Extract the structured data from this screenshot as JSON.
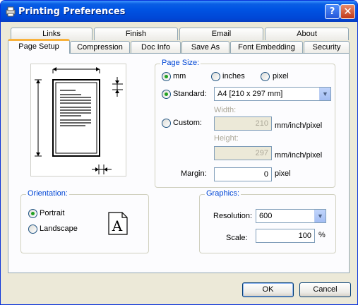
{
  "window": {
    "title": "Printing Preferences",
    "help_label": "?",
    "close_label": "✕"
  },
  "tabs_row1": [
    "Links",
    "Finish",
    "Email",
    "About"
  ],
  "tabs_row2": [
    "Page Setup",
    "Compression",
    "Doc Info",
    "Save As",
    "Font Embedding",
    "Security"
  ],
  "active_tab": "Page Setup",
  "page_size": {
    "title": "Page Size:",
    "units": [
      "mm",
      "inches",
      "pixel"
    ],
    "selected_unit": "mm",
    "standard_label": "Standard:",
    "standard_value": "A4 [210 x 297 mm]",
    "custom_label": "Custom:",
    "width_label": "Width:",
    "width_value": "210",
    "height_label": "Height:",
    "height_value": "297",
    "unit_suffix": "mm/inch/pixel",
    "selected_size": "Standard",
    "margin_label": "Margin:",
    "margin_value": "0",
    "margin_unit": "pixel"
  },
  "orientation": {
    "title": "Orientation:",
    "options": [
      "Portrait",
      "Landscape"
    ],
    "selected": "Portrait",
    "icon_letter": "A"
  },
  "graphics": {
    "title": "Graphics:",
    "resolution_label": "Resolution:",
    "resolution_value": "600",
    "scale_label": "Scale:",
    "scale_value": "100",
    "scale_unit": "%"
  },
  "buttons": {
    "ok": "OK",
    "cancel": "Cancel"
  },
  "colors": {
    "title_bar": "#0054e3",
    "group_title": "#0046d5",
    "active_tab_accent": "#f9b23c",
    "radio_dot": "#21a121"
  }
}
